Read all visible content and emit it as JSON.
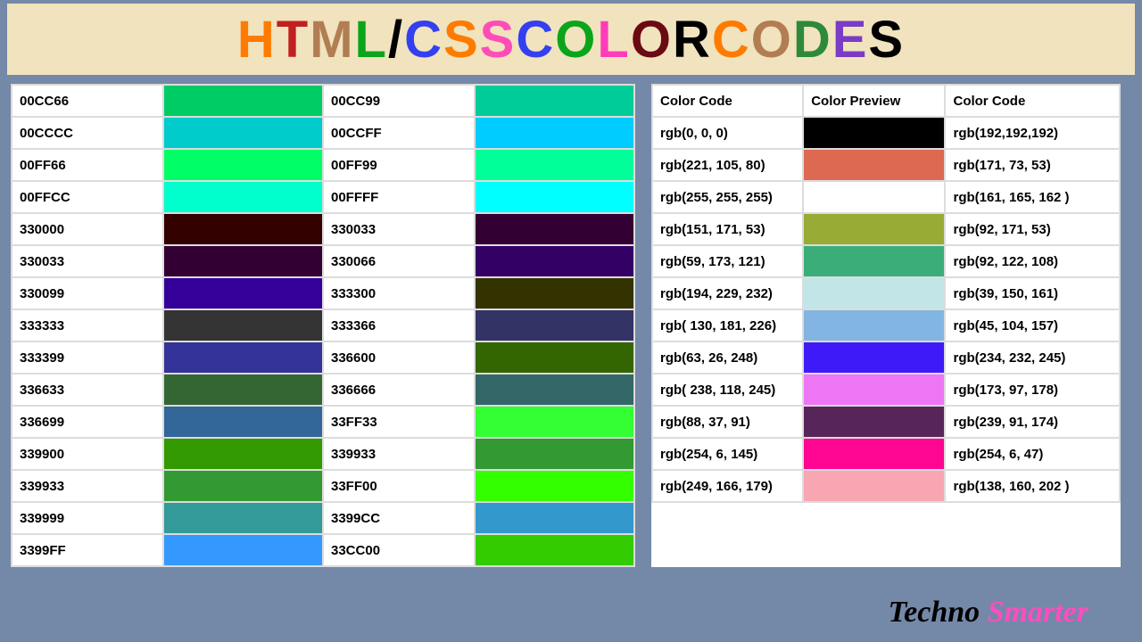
{
  "title_letters": [
    {
      "ch": "H",
      "color": "#ff7b00"
    },
    {
      "ch": "T",
      "color": "#c22020"
    },
    {
      "ch": "M",
      "color": "#b27d53"
    },
    {
      "ch": "L",
      "color": "#0aa51a"
    },
    {
      "ch": "/",
      "color": "#000000"
    },
    {
      "ch": "C",
      "color": "#3340f0"
    },
    {
      "ch": "S",
      "color": "#ff7b00"
    },
    {
      "ch": "S",
      "color": "#ff4db8"
    },
    {
      "ch": " ",
      "color": "#000"
    },
    {
      "ch": "C",
      "color": "#3340f0"
    },
    {
      "ch": "O",
      "color": "#0aa51a"
    },
    {
      "ch": "L",
      "color": "#ff3dbb"
    },
    {
      "ch": "O",
      "color": "#6a0a13"
    },
    {
      "ch": "R",
      "color": "#000000"
    },
    {
      "ch": " ",
      "color": "#000"
    },
    {
      "ch": "C",
      "color": "#ff7b00"
    },
    {
      "ch": "O",
      "color": "#b27d53"
    },
    {
      "ch": "D",
      "color": "#2e8a3a"
    },
    {
      "ch": "E",
      "color": "#7a3bc6"
    },
    {
      "ch": "S",
      "color": "#000000"
    }
  ],
  "hex_rows": [
    {
      "c1": "00CC66",
      "s1": "#00CC66",
      "c2": "00CC99",
      "s2": "#00CC99"
    },
    {
      "c1": "00CCCC",
      "s1": "#00CCCC",
      "c2": "00CCFF",
      "s2": "#00CCFF"
    },
    {
      "c1": "00FF66",
      "s1": "#00FF66",
      "c2": "00FF99",
      "s2": "#00FF99"
    },
    {
      "c1": "00FFCC",
      "s1": "#00FFCC",
      "c2": "00FFFF",
      "s2": "#00FFFF"
    },
    {
      "c1": "330000",
      "s1": "#330000",
      "c2": "330033",
      "s2": "#330033"
    },
    {
      "c1": "330033",
      "s1": "#330033",
      "c2": "330066",
      "s2": "#330066"
    },
    {
      "c1": "330099",
      "s1": "#330099",
      "c2": "333300",
      "s2": "#333300"
    },
    {
      "c1": "333333",
      "s1": "#333333",
      "c2": "333366",
      "s2": "#333366"
    },
    {
      "c1": "333399",
      "s1": "#333399",
      "c2": "336600",
      "s2": "#336600"
    },
    {
      "c1": "336633",
      "s1": "#336633",
      "c2": "336666",
      "s2": "#336666"
    },
    {
      "c1": "336699",
      "s1": "#336699",
      "c2": "33FF33",
      "s2": "#33FF33"
    },
    {
      "c1": "339900",
      "s1": "#339900",
      "c2": "339933",
      "s2": "#339933"
    },
    {
      "c1": "339933",
      "s1": "#339933",
      "c2": "33FF00",
      "s2": "#33FF00"
    },
    {
      "c1": "339999",
      "s1": "#339999",
      "c2": "3399CC",
      "s2": "#3399CC"
    },
    {
      "c1": "3399FF",
      "s1": "#3399FF",
      "c2": "33CC00",
      "s2": "#33CC00"
    }
  ],
  "rgb_headers": {
    "h1": "Color Code",
    "h2": "Color Preview",
    "h3": "Color Code"
  },
  "rgb_rows": [
    {
      "c1": "rgb(0, 0, 0)",
      "s": "rgb(0,0,0)",
      "c2": "rgb(192,192,192)"
    },
    {
      "c1": "rgb(221, 105, 80)",
      "s": "rgb(221,105,80)",
      "c2": "rgb(171, 73, 53)"
    },
    {
      "c1": "rgb(255, 255, 255)",
      "s": "rgb(255,255,255)",
      "c2": "rgb(161, 165, 162 )"
    },
    {
      "c1": "rgb(151, 171, 53)",
      "s": "rgb(151,171,53)",
      "c2": "rgb(92, 171, 53)"
    },
    {
      "c1": "rgb(59, 173, 121)",
      "s": "rgb(59,173,121)",
      "c2": "rgb(92, 122, 108)"
    },
    {
      "c1": "rgb(194, 229, 232)",
      "s": "rgb(194,229,232)",
      "c2": "rgb(39, 150, 161)"
    },
    {
      "c1": "rgb( 130, 181, 226)",
      "s": "rgb(130,181,226)",
      "c2": "rgb(45, 104, 157)"
    },
    {
      "c1": "rgb(63, 26, 248)",
      "s": "rgb(63,26,248)",
      "c2": "rgb(234, 232, 245)"
    },
    {
      "c1": "rgb( 238, 118, 245)",
      "s": "rgb(238,118,245)",
      "c2": "rgb(173, 97, 178)"
    },
    {
      "c1": "rgb(88, 37, 91)",
      "s": "rgb(88,37,91)",
      "c2": "rgb(239, 91, 174)"
    },
    {
      "c1": "rgb(254, 6, 145)",
      "s": "rgb(254,6,145)",
      "c2": "rgb(254, 6, 47)"
    },
    {
      "c1": "rgb(249, 166, 179)",
      "s": "rgb(249,166,179)",
      "c2": "rgb(138, 160, 202 )"
    }
  ],
  "footer": {
    "part1": "Techno ",
    "part2": "Smarter"
  }
}
